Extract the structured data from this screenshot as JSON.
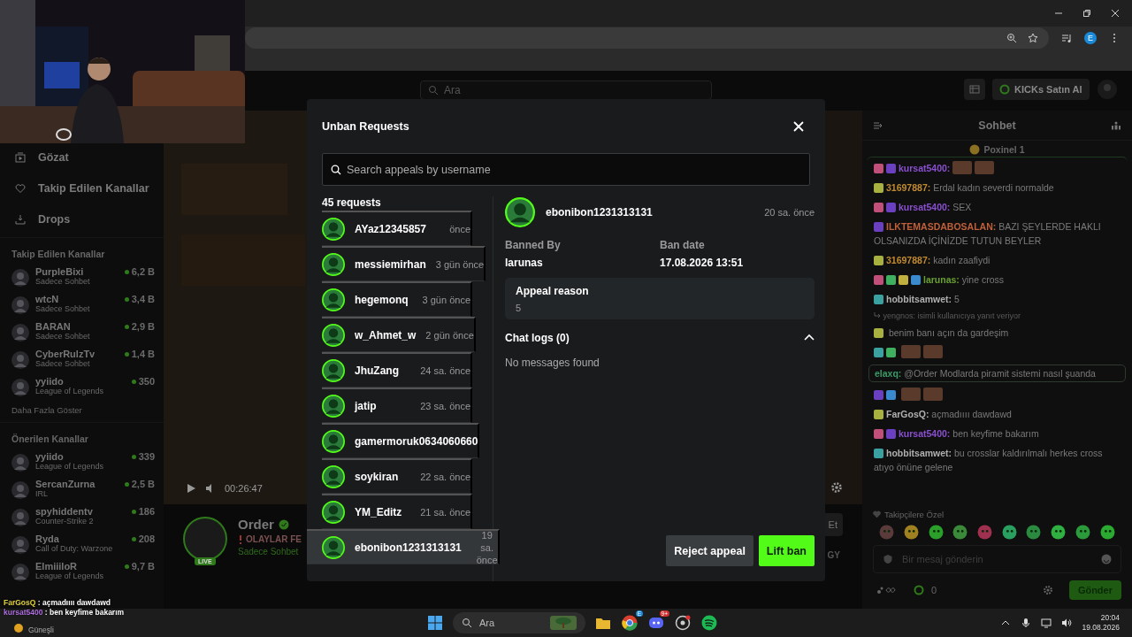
{
  "browser": {
    "profile_initial": "E"
  },
  "site_header": {
    "search_placeholder": "Ara",
    "kicks_button": "KICKs Satın Al"
  },
  "sidebar": {
    "nav": [
      {
        "label": "Gözat",
        "kind": "browse"
      },
      {
        "label": "Takip Edilen Kanallar",
        "kind": "heart"
      },
      {
        "label": "Drops",
        "kind": "drops"
      }
    ],
    "followed_title": "Takip Edilen Kanallar",
    "followed": [
      {
        "name": "PurpleBixi",
        "category": "Sadece Sohbet",
        "viewers": "6,2 B"
      },
      {
        "name": "wtcN",
        "category": "Sadece Sohbet",
        "viewers": "3,4 B"
      },
      {
        "name": "BARAN",
        "category": "Sadece Sohbet",
        "viewers": "2,9 B"
      },
      {
        "name": "CyberRulzTv",
        "category": "Sadece Sohbet",
        "viewers": "1,4 B"
      },
      {
        "name": "yyiido",
        "category": "League of Legends",
        "viewers": "350"
      }
    ],
    "more": "Daha Fazla Göster",
    "recommended_title": "Önerilen Kanallar",
    "recommended": [
      {
        "name": "yyiido",
        "category": "League of Legends",
        "viewers": "339"
      },
      {
        "name": "SercanZurna",
        "category": "IRL",
        "viewers": "2,5 B"
      },
      {
        "name": "spyhiddentv",
        "category": "Counter-Strike 2",
        "viewers": "186"
      },
      {
        "name": "Ryda",
        "category": "Call of Duty: Warzone",
        "viewers": "208"
      },
      {
        "name": "ElmiiiloR",
        "category": "League of Legends",
        "viewers": "9,7 B"
      }
    ]
  },
  "stream": {
    "elapsed": "00:26:47",
    "channel": "Order",
    "title": "OLAYLAR FE",
    "category": "Sadece Sohbet",
    "live_badge": "LIVE",
    "follow_button": "Et",
    "tag": "GY"
  },
  "modal": {
    "title": "Unban Requests",
    "search_placeholder": "Search appeals by username",
    "count": "45 requests",
    "requests": [
      {
        "name": "AYaz12345857",
        "time": "önce",
        "selected": false
      },
      {
        "name": "messiemirhan",
        "time": "3 gün önce",
        "selected": false
      },
      {
        "name": "hegemonq",
        "time": "3 gün önce",
        "selected": false
      },
      {
        "name": "w_Ahmet_w",
        "time": "2 gün önce",
        "selected": false
      },
      {
        "name": "JhuZang",
        "time": "24 sa. önce",
        "selected": false
      },
      {
        "name": "jatip",
        "time": "23 sa. önce",
        "selected": false
      },
      {
        "name": "gamermoruk0634060660",
        "selected": false
      },
      {
        "name": "soykiran",
        "time": "22 sa. önce",
        "selected": false
      },
      {
        "name": "YM_Editz",
        "time": "21 sa. önce",
        "selected": false
      },
      {
        "name": "ebonibon1231313131",
        "time": "19 sa. önce",
        "selected": true
      }
    ],
    "detail": {
      "name": "ebonibon1231313131",
      "time": "20 sa. önce",
      "banned_by_label": "Banned By",
      "banned_by": "larunas",
      "ban_date_label": "Ban date",
      "ban_date": "17.08.2026 13:51",
      "appeal_label": "Appeal reason",
      "appeal": "5",
      "chat_logs_label": "Chat logs (0)",
      "chat_logs_expanded": true,
      "empty": "No messages found"
    },
    "buttons": [
      {
        "label": "Reject appeal",
        "kind": "secondary"
      },
      {
        "label": "Lift ban",
        "kind": "primary"
      }
    ]
  },
  "chat": {
    "title": "Sohbet",
    "pinned": "Poxinel 1",
    "messages": [
      {
        "kind": "emote",
        "badges": [
          {
            "color": "#c0507a"
          },
          {
            "color": "#6a3fc0"
          }
        ],
        "user": "kursat5400:",
        "color": "#8a4fd0"
      },
      {
        "kind": "text",
        "badges": [
          {
            "color": "#a8b040"
          }
        ],
        "user": "31697887:",
        "color": "#c08a30",
        "text": "Erdal kadın severdi normalde"
      },
      {
        "kind": "text",
        "badges": [
          {
            "color": "#c0507a"
          },
          {
            "color": "#6a3fc0"
          }
        ],
        "user": "kursat5400:",
        "color": "#8a4fd0",
        "text": "SEX"
      },
      {
        "kind": "text",
        "badges": [
          {
            "color": "#6a3fc0"
          }
        ],
        "user": "ILKTEMASDABOSALAN:",
        "color": "#c0603a",
        "text": "BAZI ŞEYLERDE HAKLI OLSANIZDA İÇİNİZDE TUTUN BEYLER"
      },
      {
        "kind": "text",
        "badges": [
          {
            "color": "#a8b040"
          }
        ],
        "user": "31697887:",
        "color": "#c08a30",
        "text": "kadın zaafiydi"
      },
      {
        "kind": "text",
        "badges": [
          {
            "color": "#c0507a"
          },
          {
            "color": "#3fb060"
          },
          {
            "color": "#c0b040"
          },
          {
            "color": "#3a8ad0"
          }
        ],
        "user": "larunas:",
        "color": "#6aa030",
        "text": "yine cross"
      },
      {
        "kind": "text",
        "badges": [
          {
            "color": "#3aa0a0"
          }
        ],
        "user": "hobbitsamwet:",
        "color": "#b0b0b0",
        "text": "5"
      },
      {
        "kind": "reply",
        "user": "yengnos:",
        "text": "isimli kullanıcıya yanıt veriyor"
      },
      {
        "kind": "text",
        "badges": [
          {
            "color": "#a8b040"
          }
        ],
        "text": "benim banı açın da gardeşim"
      },
      {
        "kind": "emote",
        "badges": [
          {
            "color": "#3aa0a0"
          },
          {
            "color": "#3fb060"
          }
        ]
      },
      {
        "kind": "highlight",
        "user": "elaxq:",
        "color": "#3a9a6a",
        "text": "@Order Modlarda piramit sistemi nasıl şuanda"
      },
      {
        "kind": "emote",
        "badges": [
          {
            "color": "#6a3fc0"
          },
          {
            "color": "#3a8ad0"
          }
        ]
      },
      {
        "kind": "text",
        "badges": [
          {
            "color": "#a8b040"
          }
        ],
        "user": "FarGosQ:",
        "color": "#b0b0b0",
        "text": "açmadıııı dawdawd"
      },
      {
        "kind": "text",
        "badges": [
          {
            "color": "#c0507a"
          },
          {
            "color": "#6a3fc0"
          }
        ],
        "user": "kursat5400:",
        "color": "#8a4fd0",
        "text": "ben keyfime bakarım"
      },
      {
        "kind": "text",
        "badges": [
          {
            "color": "#3aa0a0"
          }
        ],
        "user": "hobbitsamwet:",
        "color": "#b0b0b0",
        "text": "bu crosslar kaldırılmalı herkes cross atıyo önüne gelene"
      }
    ],
    "followers_only": "Takipçilere Özel",
    "input_placeholder": "Bir mesaj gönderin",
    "points": "0",
    "send_button": "Gönder"
  },
  "stream_overlay": [
    {
      "user": "FarGosQ",
      "color": "#e0d040",
      "text": ": açmadıııı dawdawd"
    },
    {
      "user": "kursat5400",
      "color": "#b070e0",
      "text": ": ben keyfime bakarım"
    }
  ],
  "taskbar": {
    "weather": "Güneşli",
    "search_placeholder": "Ara",
    "discord_badge": "9+",
    "chrome_badge": "E",
    "time": "20:04",
    "date": "19.08.2026"
  }
}
